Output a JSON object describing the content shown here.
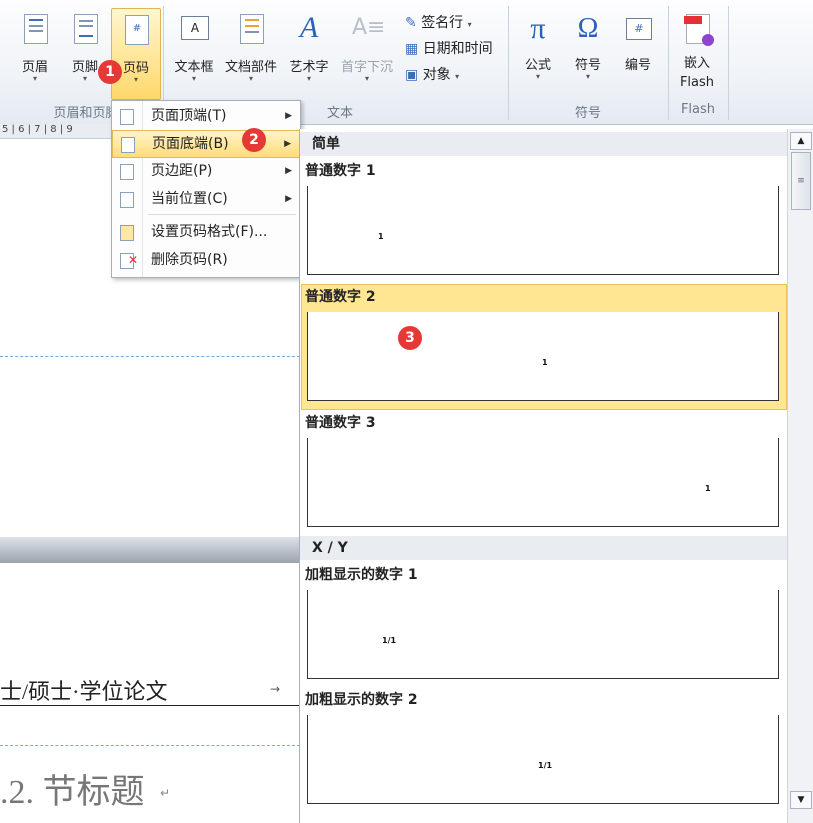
{
  "ribbon": {
    "buttons": [
      {
        "key": "header",
        "label": "页眉"
      },
      {
        "key": "footer",
        "label": "页脚"
      },
      {
        "key": "page_number",
        "label": "页码"
      },
      {
        "key": "text_box",
        "label": "文本框"
      },
      {
        "key": "quick_parts",
        "label": "文档部件"
      },
      {
        "key": "wordart",
        "label": "艺术字"
      },
      {
        "key": "drop_cap",
        "label": "首字下沉"
      },
      {
        "key": "equation",
        "label": "公式"
      },
      {
        "key": "symbol",
        "label": "符号"
      },
      {
        "key": "numbering",
        "label": "编号"
      }
    ],
    "embed_flash": {
      "line1": "嵌入",
      "line2": "Flash"
    },
    "small_buttons": {
      "signature": "签名行",
      "datetime": "日期和时间",
      "object": "对象"
    },
    "groups": {
      "header_footer": "页眉和页脚",
      "text": "文本",
      "symbols": "符号",
      "flash": "Flash"
    }
  },
  "ruler": {
    "text": "5 | 6 | 7 | 8 | 9"
  },
  "menu": {
    "items": [
      {
        "label": "页面顶端(T)",
        "has_sub": true
      },
      {
        "label": "页面底端(B)",
        "has_sub": true
      },
      {
        "label": "页边距(P)",
        "has_sub": true
      },
      {
        "label": "当前位置(C)",
        "has_sub": true
      },
      {
        "label": "设置页码格式(F)...",
        "has_sub": false
      },
      {
        "label": "删除页码(R)",
        "has_sub": false
      }
    ]
  },
  "gallery": {
    "cat_simple": "简单",
    "cat_xy": "X / Y",
    "items": [
      {
        "label": "普通数字 1",
        "num": "1"
      },
      {
        "label": "普通数字 2",
        "num": "1"
      },
      {
        "label": "普通数字 3",
        "num": "1"
      },
      {
        "label": "加粗显示的数字 1",
        "num": "1/1"
      },
      {
        "label": "加粗显示的数字 2",
        "num": "1/1"
      }
    ]
  },
  "document": {
    "header_text": "士/硕士·学位论文",
    "heading": ".2. 节标题"
  },
  "badges": {
    "b1": "1",
    "b2": "2",
    "b3": "3"
  },
  "colors": {
    "accent_highlight": "#ffe693",
    "badge": "#e53935"
  }
}
